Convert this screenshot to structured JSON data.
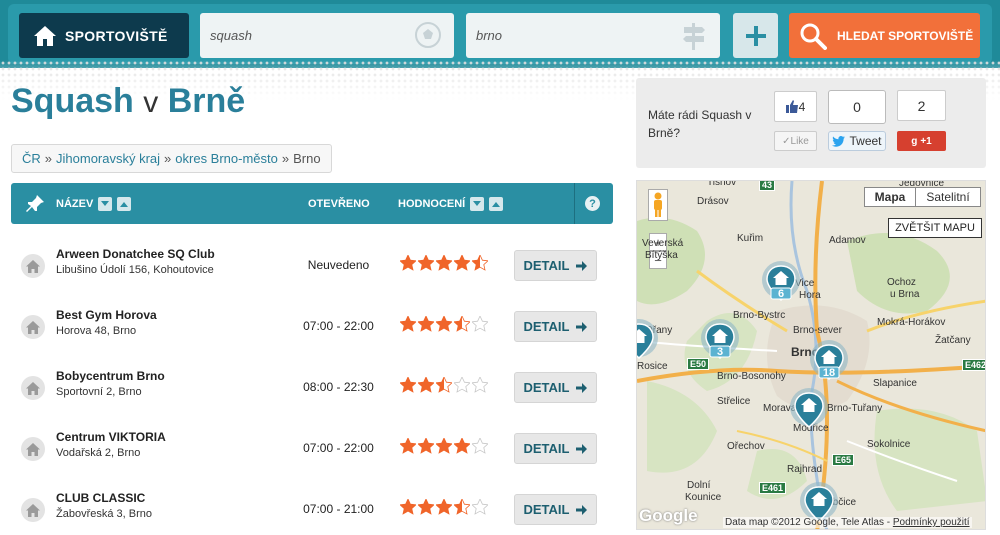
{
  "header": {
    "home_label": "SPORTOVIŠTĚ",
    "sport_value": "squash",
    "city_value": "brno",
    "search_label": "HLEDAT SPORTOVIŠTĚ"
  },
  "page": {
    "title_sport": "Squash",
    "title_v": "v",
    "title_city": "Brně"
  },
  "breadcrumb": [
    {
      "label": "ČR",
      "link": true
    },
    {
      "label": "Jihomoravský kraj",
      "link": true
    },
    {
      "label": "okres Brno-město",
      "link": true
    },
    {
      "label": "Brno",
      "link": false
    }
  ],
  "breadcrumb_sep": "»",
  "table": {
    "col_name": "NÁZEV",
    "col_open": "OTEVŘENO",
    "col_rating": "HODNOCENÍ",
    "help": "?",
    "detail_label": "DETAIL",
    "rows": [
      {
        "name": "Arween Donatchee SQ Club",
        "address": "Libušino Údolí 156, Kohoutovice",
        "hours": "Neuvedeno",
        "rating": 4.5
      },
      {
        "name": "Best Gym Horova",
        "address": "Horova 48, Brno",
        "hours": "07:00 - 22:00",
        "rating": 3.5
      },
      {
        "name": "Bobycentrum Brno",
        "address": "Sportovní 2, Brno",
        "hours": "08:00 - 22:30",
        "rating": 2.5
      },
      {
        "name": "Centrum VIKTORIA",
        "address": "Vodařská 2, Brno",
        "hours": "07:00 - 22:00",
        "rating": 4
      },
      {
        "name": "CLUB CLASSIC",
        "address": "Žabovřeská 3, Brno",
        "hours": "07:00 - 21:00",
        "rating": 3.5
      }
    ]
  },
  "social": {
    "question": "Máte rádi Squash v Brně?",
    "like_count": "4",
    "like_label": "Like",
    "tweet_count": "0",
    "tweet_label": "Tweet",
    "gplus_count": "2",
    "gplus_label": "+1"
  },
  "map": {
    "type_map": "Mapa",
    "type_sat": "Satelitní",
    "enlarge": "ZVĚTŠIT MAPU",
    "footer": "Data map ©2012 Google, Tele Atlas -",
    "terms": "Podmínky použití",
    "logo": "Google",
    "labels": [
      {
        "t": "Tišnov"
      },
      {
        "t": "Drásov"
      },
      {
        "t": "Veverská"
      },
      {
        "t": "Bítýška"
      },
      {
        "t": "Kuřim"
      },
      {
        "t": "Adamov"
      },
      {
        "t": "Jedovnice"
      },
      {
        "t": "Ochoz"
      },
      {
        "t": "u Brna"
      },
      {
        "t": "Mokrá-Horákov"
      },
      {
        "t": "Brno-Bystrc"
      },
      {
        "t": "Brno-sever"
      },
      {
        "t": "Brno"
      },
      {
        "t": "Brno-Bosonohy"
      },
      {
        "t": "Slapanice"
      },
      {
        "t": "Střelice"
      },
      {
        "t": "Moravany"
      },
      {
        "t": "Brno-Tuřany"
      },
      {
        "t": "Modřice"
      },
      {
        "t": "Sokolnice"
      },
      {
        "t": "Ořechov"
      },
      {
        "t": "Rajhrad"
      },
      {
        "t": "Dolní"
      },
      {
        "t": "Kounice"
      },
      {
        "t": "Žabčice"
      },
      {
        "t": "Rosice"
      },
      {
        "t": "Ořany"
      },
      {
        "t": "Vice"
      },
      {
        "t": "Hora"
      },
      {
        "t": "Žatčany"
      }
    ],
    "road_badges": [
      "43",
      "E50",
      "E461",
      "E65",
      "E462"
    ],
    "clusters": [
      {
        "count": "6"
      },
      {
        "count": "3"
      },
      {
        "count": "18"
      },
      {
        "count": ""
      },
      {
        "count": ""
      },
      {
        "count": ""
      }
    ]
  },
  "colors": {
    "header_bg": "#2a9aab",
    "home_bg": "#0d3a4d",
    "accent_orange": "#f2703a",
    "title_blue": "#2a7f9a",
    "star": "#f0652a",
    "star_empty": "#d0d0d0"
  }
}
